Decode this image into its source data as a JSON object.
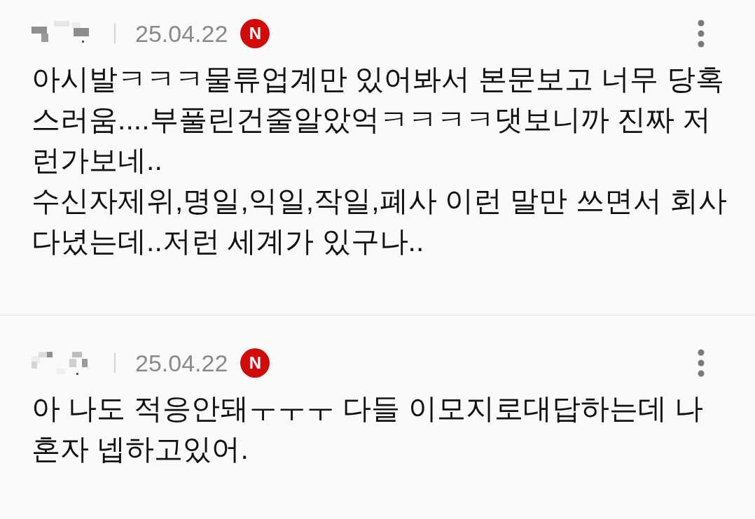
{
  "comments": [
    {
      "date": "25.04.22",
      "badge": "N",
      "body": "아시발ㅋㅋㅋ물류업계만 있어봐서 본문보고 너무 당혹\n스러움....부풀린건줄알았억ㅋㅋㅋㅋ댓보니까 진짜 저\n런가보네..\n수신자제위,명일,익일,작일,폐사 이런 말만 쓰면서 회사\n다녔는데..저런 세계가 있구나.."
    },
    {
      "date": "25.04.22",
      "badge": "N",
      "body": "아 나도 적응안돼ㅜㅜㅜ 다들 이모지로대답하는데 나\n혼자 넵하고있어."
    }
  ]
}
